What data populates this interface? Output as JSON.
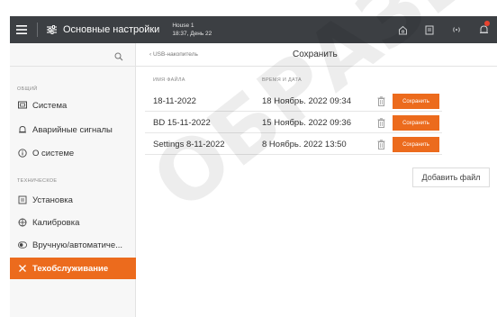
{
  "header": {
    "title": "Основные настройки",
    "device_name": "House 1",
    "device_time": "18:37, День 22"
  },
  "sidebar": {
    "sections": [
      {
        "label": "ОБЩИЙ",
        "items": [
          {
            "label": "Система",
            "icon": "monitor-icon"
          },
          {
            "label": "Аварийные сигналы",
            "icon": "bell-icon"
          },
          {
            "label": "О системе",
            "icon": "info-icon"
          }
        ]
      },
      {
        "label": "ТЕХНИЧЕСКОЕ",
        "items": [
          {
            "label": "Установка",
            "icon": "install-icon"
          },
          {
            "label": "Калибровка",
            "icon": "calibration-icon"
          },
          {
            "label": "Вручную/автоматиче...",
            "icon": "toggle-icon"
          },
          {
            "label": "Техобслуживание",
            "icon": "wrench-icon",
            "active": true
          }
        ]
      }
    ]
  },
  "main": {
    "breadcrumb": "USB-накопитель",
    "title": "Сохранить",
    "columns": [
      "ИМЯ ФАЙЛА",
      "ВРЕМЯ И ДАТА"
    ],
    "rows": [
      {
        "name": "18-11-2022",
        "datetime": "18 Ноябрь. 2022 09:34",
        "button": "Сохранить"
      },
      {
        "name": "BD 15-11-2022",
        "datetime": "15 Ноябрь. 2022 09:36",
        "button": "Сохранить"
      },
      {
        "name": "Settings 8-11-2022",
        "datetime": "8 Ноябрь. 2022 13:50",
        "button": "Сохранить"
      }
    ],
    "add_file_label": "Добавить файл"
  },
  "watermark": "ОБРАЗЕЦ",
  "colors": {
    "topbar": "#3c3f43",
    "accent": "#ec6b1d",
    "sidebar": "#f7f7f7"
  }
}
